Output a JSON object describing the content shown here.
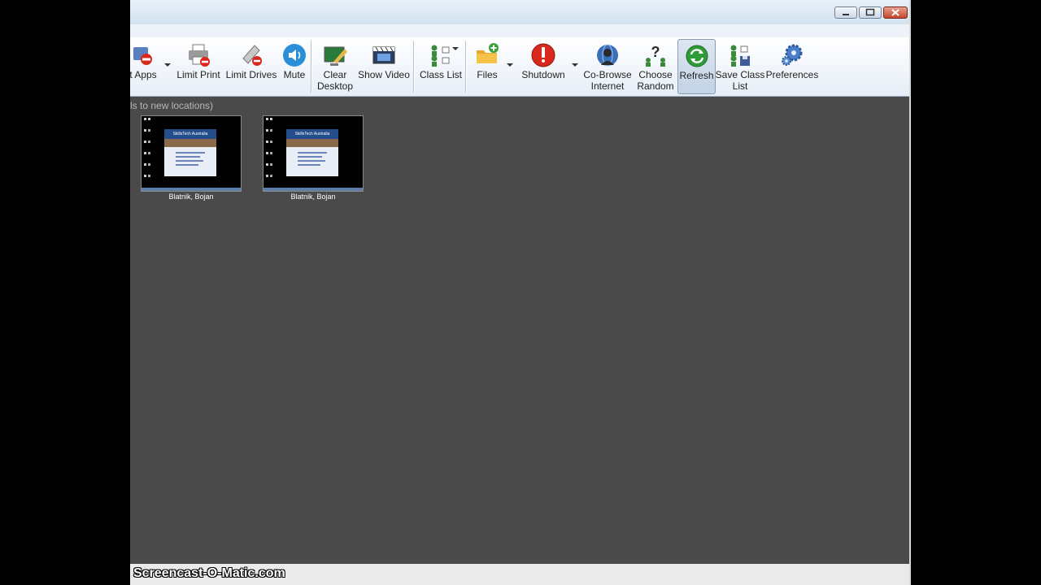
{
  "toolbar": {
    "items": [
      {
        "label": "t Apps",
        "icon": "block-apps-icon"
      },
      {
        "label": "Limit Print",
        "icon": "printer-blocked-icon"
      },
      {
        "label": "Limit Drives",
        "icon": "drive-blocked-icon"
      },
      {
        "label": "Mute",
        "icon": "speaker-icon"
      },
      {
        "label": "Clear\nDesktop",
        "icon": "clear-desktop-icon"
      },
      {
        "label": "Show Video",
        "icon": "video-clapper-icon"
      },
      {
        "label": "Class List",
        "icon": "class-list-icon"
      },
      {
        "label": "Files",
        "icon": "folder-add-icon"
      },
      {
        "label": "Shutdown",
        "icon": "shutdown-icon"
      },
      {
        "label": "Co-Browse\nInternet",
        "icon": "co-browse-icon"
      },
      {
        "label": "Choose\nRandom",
        "icon": "question-people-icon"
      },
      {
        "label": "Refresh",
        "icon": "refresh-icon"
      },
      {
        "label": "Save Class\nList",
        "icon": "save-class-list-icon"
      },
      {
        "label": "Preferences",
        "icon": "gear-icon"
      }
    ],
    "active_item": "Refresh"
  },
  "hint_text": "ls to new locations)",
  "students": [
    {
      "name": "Blatnik, Bojan",
      "slide_title": "SkillsTech Australia"
    },
    {
      "name": "Blatnik, Bojan",
      "slide_title": "SkillsTech Australia"
    }
  ],
  "watermark": "Screencast-O-Matic.com",
  "colors": {
    "accent": "#244d8c",
    "background": "#4a4a4a",
    "ribbon": "#e6eef8"
  }
}
